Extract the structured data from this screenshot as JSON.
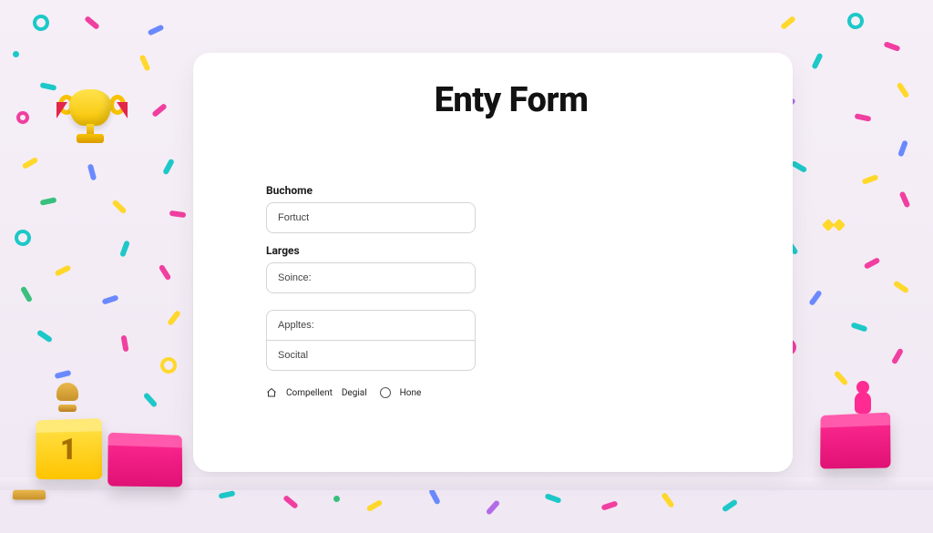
{
  "title": "Enty Form",
  "fields": {
    "buchome": {
      "label": "Buchome",
      "value": "Fortuct"
    },
    "larges": {
      "label": "Larges",
      "value": "Soince:"
    },
    "stacked": {
      "top_value": "Appltes:",
      "bottom_value": "Socital"
    }
  },
  "radios": {
    "opt1": {
      "label": "Compellent"
    },
    "opt2": {
      "label": "Degial"
    },
    "opt3": {
      "label": "Hone"
    }
  },
  "podium_number": "1"
}
